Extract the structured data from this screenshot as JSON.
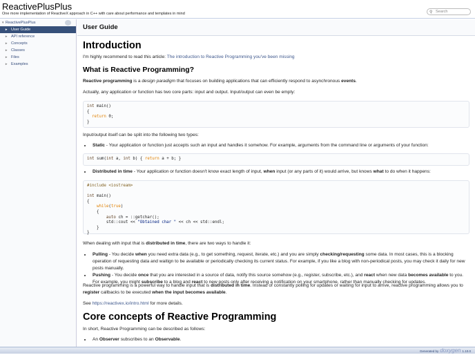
{
  "header": {
    "project": "ReactivePlusPlus",
    "brief": "One more implementation of ReactiveX approach in C++ with care about performance and templates in mind",
    "search_placeholder": "Search"
  },
  "sidebar": {
    "root": "ReactivePlusPlus",
    "items": [
      {
        "label": "User Guide",
        "selected": true
      },
      {
        "label": "API reference"
      },
      {
        "label": "Concepts"
      },
      {
        "label": "Classes"
      },
      {
        "label": "Files"
      },
      {
        "label": "Examples"
      }
    ]
  },
  "page": {
    "title": "User Guide",
    "intro_h": "Introduction",
    "intro_text": "I'm highly recommend to read this article: ",
    "intro_link": "The introduction to Reactive Programming you've been missing",
    "what_h": "What is Reactive Programming?",
    "p1a": "Reactive programming",
    "p1b": " is a ",
    "p1c": "design paradigm",
    "p1d": " that focuses on building applications that can efficiently respond to asynchronous ",
    "p1e": "events",
    "p1f": ".",
    "p2": "Actually, any application or function has two core parts: input and output. Input/output can even be empty:",
    "p3": "Input/output itself can be split into the following two types:",
    "static_b": "Static",
    "static_t": " - Your application or function just accepts such an input and handles it somehow. For example, arguments from the command line or arguments of your function:",
    "dist_b": "Distributed in time",
    "dist_t1": " - Your application or function doesn't know exact length of input, ",
    "dist_w": "when",
    "dist_t2": " input (or any parts of it) would arrive, but knows ",
    "dist_what": "what",
    "dist_t3": " to do when it happens:",
    "p4a": "When dealing with input that is ",
    "p4b": "distributed in time",
    "p4c": ", there are two ways to handle it:",
    "pull_b": "Pulling",
    "pull_t1": " - You decide ",
    "pull_w": "when",
    "pull_t2": " you need extra data (e.g., to get something, request, iterate, etc.) and you are simply ",
    "pull_c": "checking/requesting",
    "pull_t3": " some data. In most cases, this is a blocking operation of requesting data and waitign to be available or periodically checking its current status. For example, if you like a blog with non-periodical posts, you may check it daily for new posts manually.",
    "push_b": "Pushing",
    "push_t1": " - You decide ",
    "push_o": "once",
    "push_t2": " that you are interested in a source of data, notify this source somehow (e.g., register, subscribe, etc.), and ",
    "push_r": "react",
    "push_t3": " when new data ",
    "push_ba": "becomes available",
    "push_t4": " to you. For example, you might ",
    "push_s": "subscribe",
    "push_t5": " to a blog and ",
    "push_r2": "react",
    "push_t6": " to new posts only after receiving a notification on your smartphone, rather than manually checking for updates.",
    "p5a": "Reactive programming is a powerful way to handle input that is ",
    "p5b": "distributed in time",
    "p5c": ". Instead of constantly polling for updates or waiting for input to arrive, reactive programming allows you to ",
    "p5d": "register",
    "p5e": " callbacks to be executed ",
    "p5f": "when the input becomes available",
    "p5g": ".",
    "see_a": "See ",
    "see_link": "https://reactivex.io/intro.html",
    "see_b": " for more details.",
    "core_h": "Core concepts of Reactive Programming",
    "core_p": "In short, Reactive Programming can be described as follows:",
    "obs_a": "An ",
    "obs_b": "Observer",
    "obs_c": " subscribes to an ",
    "obs_d": "Observable",
    "obs_e": "."
  },
  "footer": {
    "generated": "Generated by",
    "logo": "doxygen",
    "version": "1.10.0"
  }
}
